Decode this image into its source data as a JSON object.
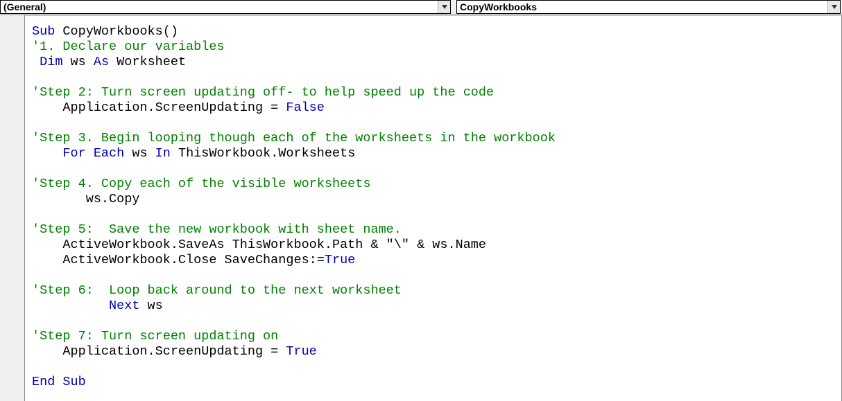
{
  "toolbar": {
    "object_dropdown": "(General)",
    "procedure_dropdown": "CopyWorkbooks"
  },
  "code": {
    "lines": [
      [
        {
          "t": "kw",
          "v": "Sub "
        },
        {
          "t": "pl",
          "v": "CopyWorkbooks()"
        }
      ],
      [
        {
          "t": "cm",
          "v": "'1. Declare our variables"
        }
      ],
      [
        {
          "t": "pl",
          "v": " "
        },
        {
          "t": "kw",
          "v": "Dim "
        },
        {
          "t": "pl",
          "v": "ws "
        },
        {
          "t": "kw",
          "v": "As "
        },
        {
          "t": "pl",
          "v": "Worksheet"
        }
      ],
      [
        {
          "t": "pl",
          "v": ""
        }
      ],
      [
        {
          "t": "cm",
          "v": "'Step 2: Turn screen updating off- to help speed up the code"
        }
      ],
      [
        {
          "t": "pl",
          "v": "    Application.ScreenUpdating = "
        },
        {
          "t": "kw",
          "v": "False"
        }
      ],
      [
        {
          "t": "pl",
          "v": ""
        }
      ],
      [
        {
          "t": "cm",
          "v": "'Step 3. Begin looping though each of the worksheets in the workbook"
        }
      ],
      [
        {
          "t": "pl",
          "v": "    "
        },
        {
          "t": "kw",
          "v": "For Each "
        },
        {
          "t": "pl",
          "v": "ws "
        },
        {
          "t": "kw",
          "v": "In "
        },
        {
          "t": "pl",
          "v": "ThisWorkbook.Worksheets"
        }
      ],
      [
        {
          "t": "pl",
          "v": ""
        }
      ],
      [
        {
          "t": "cm",
          "v": "'Step 4. Copy each of the visible worksheets"
        }
      ],
      [
        {
          "t": "pl",
          "v": "       ws.Copy"
        }
      ],
      [
        {
          "t": "pl",
          "v": ""
        }
      ],
      [
        {
          "t": "cm",
          "v": "'Step 5:  Save the new workbook with sheet name."
        }
      ],
      [
        {
          "t": "pl",
          "v": "    ActiveWorkbook.SaveAs ThisWorkbook.Path & \"\\\" & ws.Name"
        }
      ],
      [
        {
          "t": "pl",
          "v": "    ActiveWorkbook.Close SaveChanges:="
        },
        {
          "t": "kw",
          "v": "True"
        }
      ],
      [
        {
          "t": "pl",
          "v": ""
        }
      ],
      [
        {
          "t": "cm",
          "v": "'Step 6:  Loop back around to the next worksheet"
        }
      ],
      [
        {
          "t": "pl",
          "v": "          "
        },
        {
          "t": "kw",
          "v": "Next "
        },
        {
          "t": "pl",
          "v": "ws"
        }
      ],
      [
        {
          "t": "pl",
          "v": ""
        }
      ],
      [
        {
          "t": "cm",
          "v": "'Step 7: Turn screen updating on"
        }
      ],
      [
        {
          "t": "pl",
          "v": "    Application.ScreenUpdating = "
        },
        {
          "t": "kw",
          "v": "True"
        }
      ],
      [
        {
          "t": "pl",
          "v": ""
        }
      ],
      [
        {
          "t": "kw",
          "v": "End Sub"
        }
      ]
    ]
  }
}
